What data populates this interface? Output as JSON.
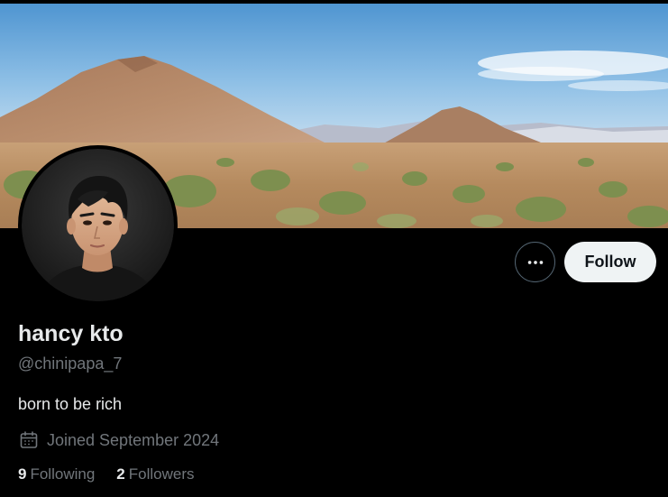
{
  "profile": {
    "display_name": "hancy kto",
    "handle": "@chinipapa_7",
    "bio": "born to be rich",
    "joined": "Joined September 2024",
    "following_count": "9",
    "following_label": "Following",
    "followers_count": "2",
    "followers_label": "Followers"
  },
  "actions": {
    "follow_label": "Follow",
    "more_icon": "ellipsis-icon"
  },
  "icons": {
    "joined": "calendar-icon"
  },
  "colors": {
    "background": "#000000",
    "primary_text": "#e7e9ea",
    "secondary_text": "#71767b",
    "follow_button_bg": "#eff3f4",
    "follow_button_text": "#0f1419",
    "outline_border": "#536471"
  }
}
